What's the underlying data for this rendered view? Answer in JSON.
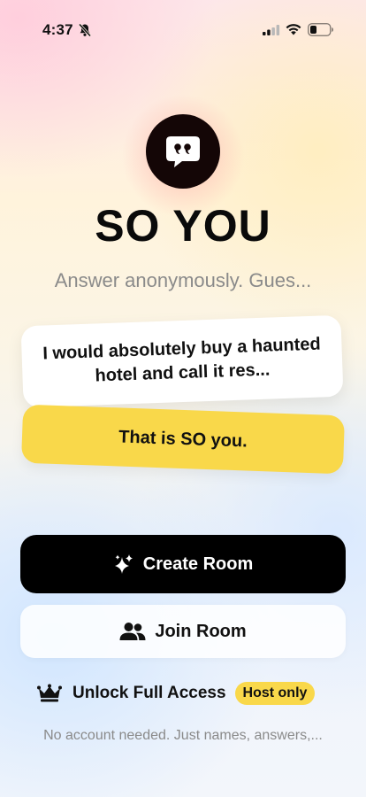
{
  "status_bar": {
    "time": "4:37",
    "icons": [
      "bell-slash-icon",
      "cellular-signal-icon",
      "wifi-icon",
      "battery-icon"
    ]
  },
  "brand": {
    "logo_icon": "quote-bubble-icon",
    "title": "SO YOU",
    "subtitle": "Answer anonymously. Gues..."
  },
  "preview": {
    "answer_card": "I would absolutely buy a haunted hotel and call it res...",
    "reaction_card": "That is SO you."
  },
  "actions": {
    "create_room": {
      "label": "Create Room",
      "icon": "sparkles-icon"
    },
    "join_room": {
      "label": "Join Room",
      "icon": "people-icon"
    }
  },
  "unlock": {
    "icon": "crown-icon",
    "label": "Unlock Full Access",
    "badge": "Host only"
  },
  "footer": "No account needed. Just names, answers,...",
  "colors": {
    "accent_yellow": "#f9d84a",
    "primary_black": "#000000",
    "logo_bg": "#140606",
    "muted_text": "#8a8a8a"
  }
}
